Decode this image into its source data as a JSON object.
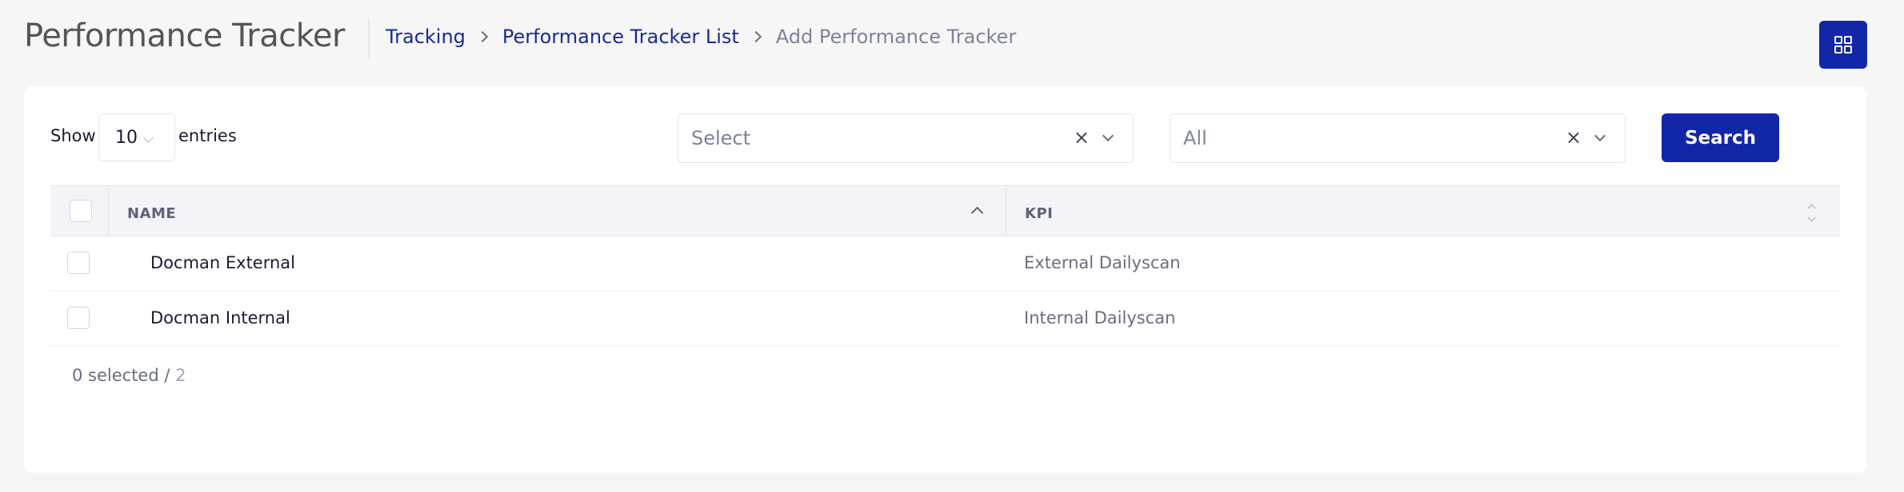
{
  "header": {
    "title": "Performance Tracker",
    "breadcrumb": [
      "Tracking",
      "Performance Tracker List",
      "Add Performance Tracker"
    ],
    "grid_icon": "grid-icon"
  },
  "toolbar": {
    "show_label": "Show",
    "page_length": "10",
    "entries_label": "entries",
    "filter1_value": "Select",
    "filter2_value": "All",
    "clear_glyph": "×",
    "search_label": "Search"
  },
  "table": {
    "columns": [
      "NAME",
      "KPI"
    ],
    "rows": [
      {
        "name": "Docman External",
        "kpi": "External Dailyscan"
      },
      {
        "name": "Docman Internal",
        "kpi": "Internal Dailyscan"
      }
    ]
  },
  "footer": {
    "selected": "0 selected",
    "separator": " / ",
    "total": "2"
  },
  "colors": {
    "accent": "#1226a8",
    "link": "#1a2a9a"
  }
}
